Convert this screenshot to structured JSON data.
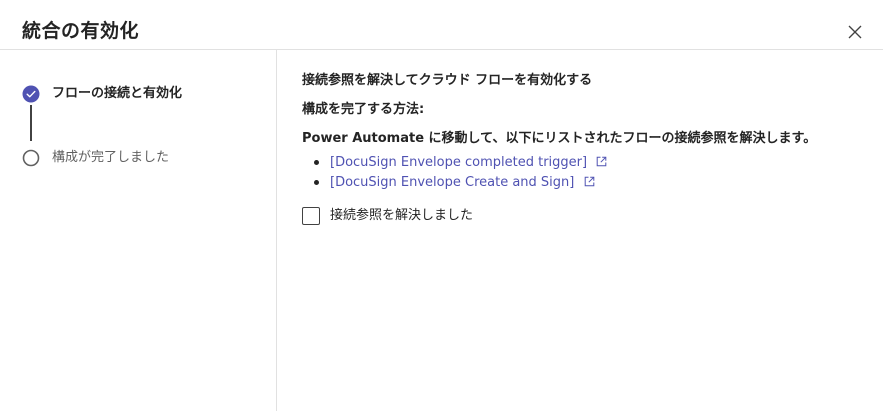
{
  "dialog": {
    "title": "統合の有効化",
    "close_icon": "close-icon"
  },
  "steps": [
    {
      "label": "フローの接続と有効化",
      "state": "completed",
      "icon": "check-circle-icon"
    },
    {
      "label": "構成が完了しました",
      "state": "pending",
      "icon": "empty-circle-icon"
    }
  ],
  "main": {
    "heading": "接続参照を解決してクラウド フローを有効化する",
    "subheading": "構成を完了する方法:",
    "instruction": "Power Automate に移動して、以下にリストされたフローの接続参照を解決します。",
    "links": [
      {
        "label": "[DocuSign Envelope completed trigger]",
        "icon": "external-link-icon"
      },
      {
        "label": "[DocuSign Envelope Create and Sign]",
        "icon": "external-link-icon"
      }
    ],
    "checkbox_label": "接続参照を解決しました"
  },
  "colors": {
    "accent": "#4f52b2",
    "text": "#242424",
    "muted": "#616161",
    "divider": "#e1e1e1"
  }
}
